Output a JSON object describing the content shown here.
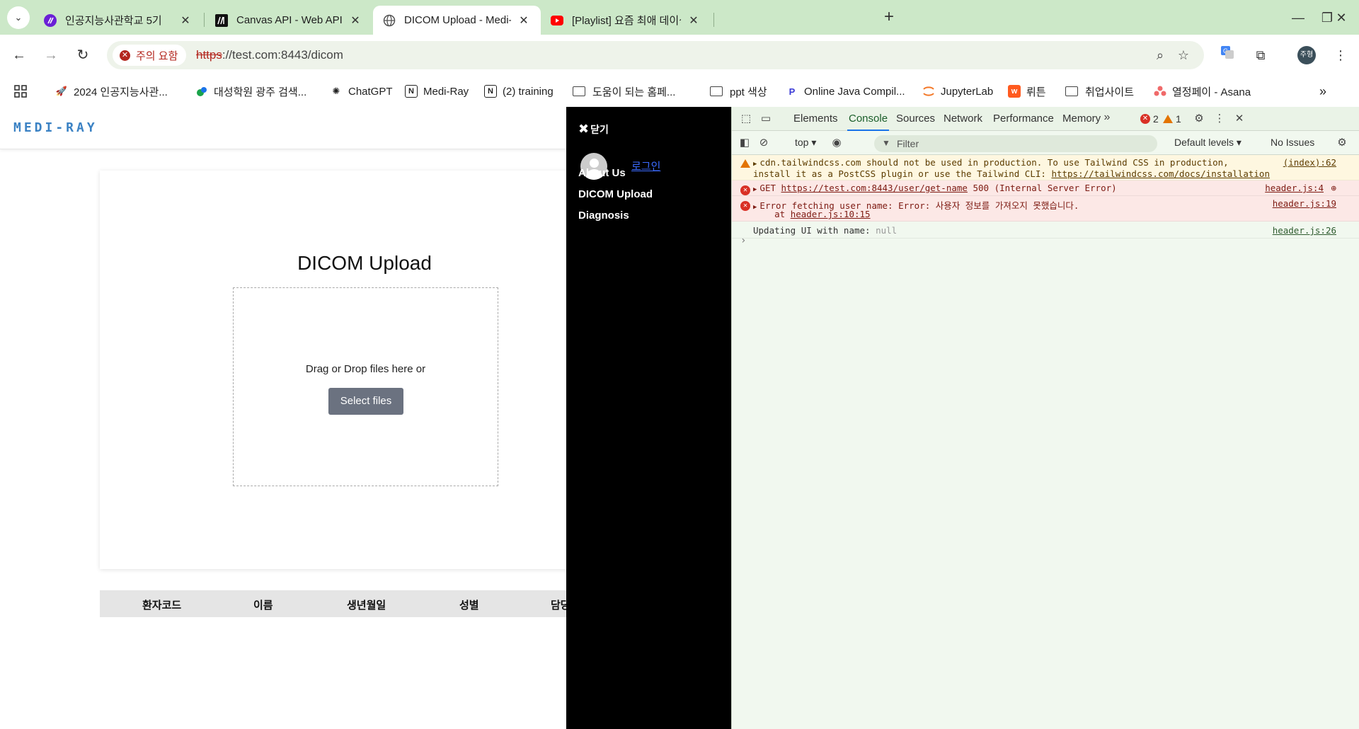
{
  "browser": {
    "tabs": [
      {
        "title": "인공지능사관학교 5기",
        "icon": "purple-circle-icon",
        "active": false
      },
      {
        "title": "Canvas API - Web APIs | MDN",
        "icon": "mdn-icon",
        "active": false
      },
      {
        "title": "DICOM Upload - Medi-Ray",
        "icon": "globe-icon",
        "active": true
      },
      {
        "title": "[Playlist] 요즘 최애 데이식스 🎹",
        "icon": "youtube-icon",
        "active": false
      }
    ],
    "security_label": "주의 요함",
    "url_scheme": "https",
    "url_rest": "://test.com:8443/dicom",
    "profile_initials": "주형"
  },
  "bookmarks": [
    {
      "label": "2024 인공지능사관...",
      "icon": "rocket-icon"
    },
    {
      "label": "대성학원 광주 검색...",
      "icon": "leaf-icon"
    },
    {
      "label": "ChatGPT",
      "icon": "openai-icon"
    },
    {
      "label": "Medi-Ray",
      "icon": "notion-icon"
    },
    {
      "label": "(2) training",
      "icon": "notion-icon"
    },
    {
      "label": "도움이 되는 홈페...",
      "icon": "folder-icon"
    },
    {
      "label": "ppt 색상",
      "icon": "folder-icon"
    },
    {
      "label": "Online Java Compil...",
      "icon": "p-icon"
    },
    {
      "label": "JupyterLab",
      "icon": "jupyter-icon"
    },
    {
      "label": "뤼튼",
      "icon": "wrtn-icon"
    },
    {
      "label": "취업사이트",
      "icon": "folder-icon"
    },
    {
      "label": "열정페이 - Asana",
      "icon": "asana-icon"
    }
  ],
  "site": {
    "logo": "MEDI-RAY",
    "title": "DICOM Upload",
    "drop_text": "Drag or Drop files here or",
    "select_button": "Select files",
    "table_headers": [
      "환자코드",
      "이름",
      "생년월일",
      "성별",
      "담당"
    ]
  },
  "drawer": {
    "close_label": "닫기",
    "login_label": "로그인",
    "menu": [
      "About Us",
      "DICOM Upload",
      "Diagnosis"
    ]
  },
  "devtools": {
    "tabs": [
      "Elements",
      "Console",
      "Sources",
      "Network",
      "Performance",
      "Memory"
    ],
    "active_tab": "Console",
    "error_count": "2",
    "warning_count": "1",
    "context": "top",
    "filter_placeholder": "Filter",
    "levels": "Default levels",
    "issues": "No Issues",
    "messages": {
      "warn_line1": "cdn.tailwindcss.com should not be used in production. To use Tailwind CSS in production,",
      "warn_line2": "install it as a PostCSS plugin or use the Tailwind CLI: ",
      "warn_link": "https://tailwindcss.com/docs/installation",
      "warn_src": "(index):62",
      "get_prefix": "GET ",
      "get_url": "https://test.com:8443/user/get-name",
      "get_suffix": " 500 (Internal Server Error)",
      "get_src": "header.js:4",
      "err_line1": "Error fetching user name: Error: 사용자 정보를 가져오지 못했습니다.",
      "err_at": "    at ",
      "err_at_link": "header.js:10:15",
      "err_src": "header.js:19",
      "log_text": "Updating UI with name: ",
      "log_value": "null",
      "log_src": "header.js:26"
    }
  },
  "colors": {
    "tabstrip": "#cce8c8",
    "logo": "#3b82c4",
    "select_button": "#6b7280",
    "error": "#d93025",
    "warning": "#e37400"
  }
}
